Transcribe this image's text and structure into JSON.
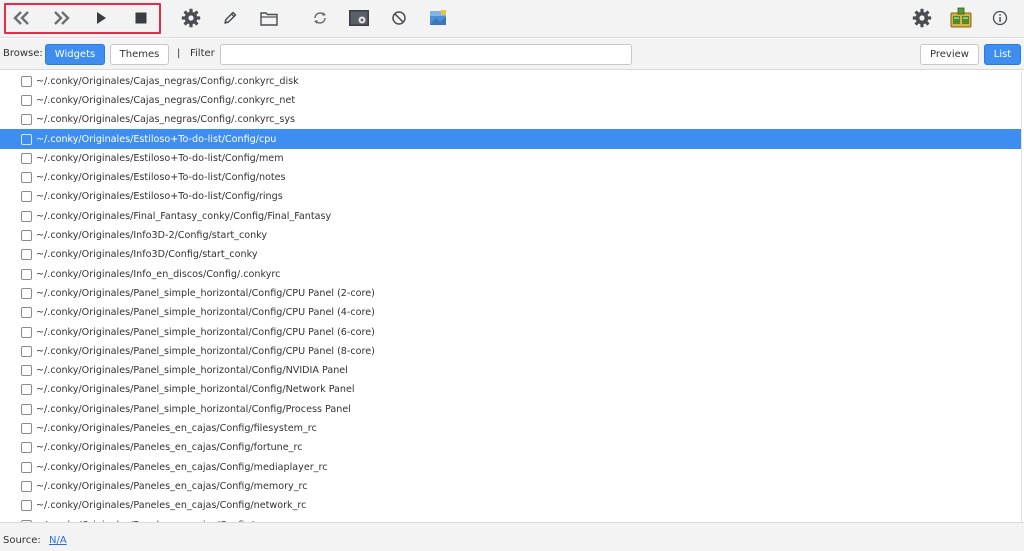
{
  "toolbar": {
    "icons": [
      "rewind-icon",
      "fast-forward-icon",
      "play-icon",
      "stop-icon",
      "gear-icon",
      "pencil-icon",
      "folder-icon",
      "refresh-icon",
      "screen-settings-icon",
      "ban-icon",
      "image-icon",
      "settings-icon",
      "conky-icon",
      "info-icon"
    ],
    "highlight_color": "#e8294a"
  },
  "browse": {
    "label": "Browse:",
    "widgets_label": "Widgets",
    "themes_label": "Themes",
    "separator": "|",
    "filter_label": "Filter",
    "filter_value": "",
    "preview_label": "Preview",
    "list_label": "List",
    "accent_color": "#3d8ef0"
  },
  "list": {
    "items": [
      {
        "path": "~/.conky/Originales/Cajas_negras/Config/.conkyrc_disk",
        "selected": false
      },
      {
        "path": "~/.conky/Originales/Cajas_negras/Config/.conkyrc_net",
        "selected": false
      },
      {
        "path": "~/.conky/Originales/Cajas_negras/Config/.conkyrc_sys",
        "selected": false
      },
      {
        "path": "~/.conky/Originales/Estiloso+To-do-list/Config/cpu",
        "selected": true
      },
      {
        "path": "~/.conky/Originales/Estiloso+To-do-list/Config/mem",
        "selected": false
      },
      {
        "path": "~/.conky/Originales/Estiloso+To-do-list/Config/notes",
        "selected": false
      },
      {
        "path": "~/.conky/Originales/Estiloso+To-do-list/Config/rings",
        "selected": false
      },
      {
        "path": "~/.conky/Originales/Final_Fantasy_conky/Config/Final_Fantasy",
        "selected": false
      },
      {
        "path": "~/.conky/Originales/Info3D-2/Config/start_conky",
        "selected": false
      },
      {
        "path": "~/.conky/Originales/Info3D/Config/start_conky",
        "selected": false
      },
      {
        "path": "~/.conky/Originales/Info_en_discos/Config/.conkyrc",
        "selected": false
      },
      {
        "path": "~/.conky/Originales/Panel_simple_horizontal/Config/CPU Panel (2-core)",
        "selected": false
      },
      {
        "path": "~/.conky/Originales/Panel_simple_horizontal/Config/CPU Panel (4-core)",
        "selected": false
      },
      {
        "path": "~/.conky/Originales/Panel_simple_horizontal/Config/CPU Panel (6-core)",
        "selected": false
      },
      {
        "path": "~/.conky/Originales/Panel_simple_horizontal/Config/CPU Panel (8-core)",
        "selected": false
      },
      {
        "path": "~/.conky/Originales/Panel_simple_horizontal/Config/NVIDIA Panel",
        "selected": false
      },
      {
        "path": "~/.conky/Originales/Panel_simple_horizontal/Config/Network Panel",
        "selected": false
      },
      {
        "path": "~/.conky/Originales/Panel_simple_horizontal/Config/Process Panel",
        "selected": false
      },
      {
        "path": "~/.conky/Originales/Paneles_en_cajas/Config/filesystem_rc",
        "selected": false
      },
      {
        "path": "~/.conky/Originales/Paneles_en_cajas/Config/fortune_rc",
        "selected": false
      },
      {
        "path": "~/.conky/Originales/Paneles_en_cajas/Config/mediaplayer_rc",
        "selected": false
      },
      {
        "path": "~/.conky/Originales/Paneles_en_cajas/Config/memory_rc",
        "selected": false
      },
      {
        "path": "~/.conky/Originales/Paneles_en_cajas/Config/network_rc",
        "selected": false
      },
      {
        "path": "~/.conky/Originales/Paneles_en_cajas/Config/",
        "selected": false
      }
    ]
  },
  "status": {
    "label": "Source:",
    "value": "N/A"
  }
}
